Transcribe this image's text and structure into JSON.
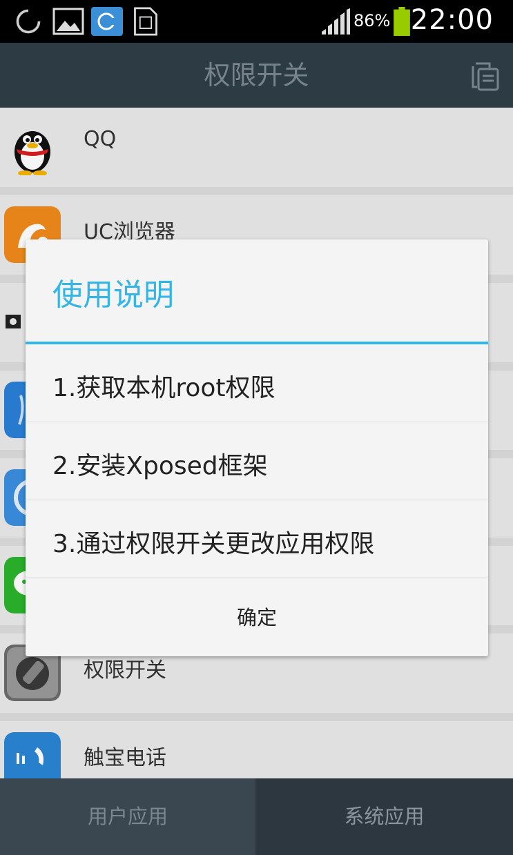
{
  "status_bar": {
    "battery_percent": "86%",
    "time": "22:00",
    "icons": [
      "loading-circle-icon",
      "image-icon",
      "sync-icon",
      "sim-card-icon",
      "signal-icon",
      "battery-icon"
    ]
  },
  "header": {
    "title": "权限开关",
    "action_icon": "copy-icon"
  },
  "app_list": {
    "items": [
      {
        "label": "QQ",
        "icon": "qq-penguin-icon"
      },
      {
        "label": "UC浏览器",
        "icon": "uc-browser-icon"
      },
      {
        "label": "",
        "icon": "camera-app-icon"
      },
      {
        "label": "",
        "icon": "blue-app-icon"
      },
      {
        "label": "",
        "icon": "blue-circle-app-icon"
      },
      {
        "label": "",
        "icon": "wechat-icon"
      },
      {
        "label": "权限开关",
        "icon": "permission-switch-icon"
      },
      {
        "label": "触宝电话",
        "icon": "touchpal-dialer-icon"
      }
    ]
  },
  "dialog": {
    "title": "使用说明",
    "steps": [
      "1.获取本机root权限",
      "2.安装Xposed框架",
      "3.通过权限开关更改应用权限"
    ],
    "ok_label": "确定"
  },
  "bottom_tabs": {
    "user_apps": "用户应用",
    "system_apps": "系统应用"
  },
  "colors": {
    "accent": "#33b5e5",
    "header_bg": "#2f3e48",
    "battery": "#99cc00"
  }
}
